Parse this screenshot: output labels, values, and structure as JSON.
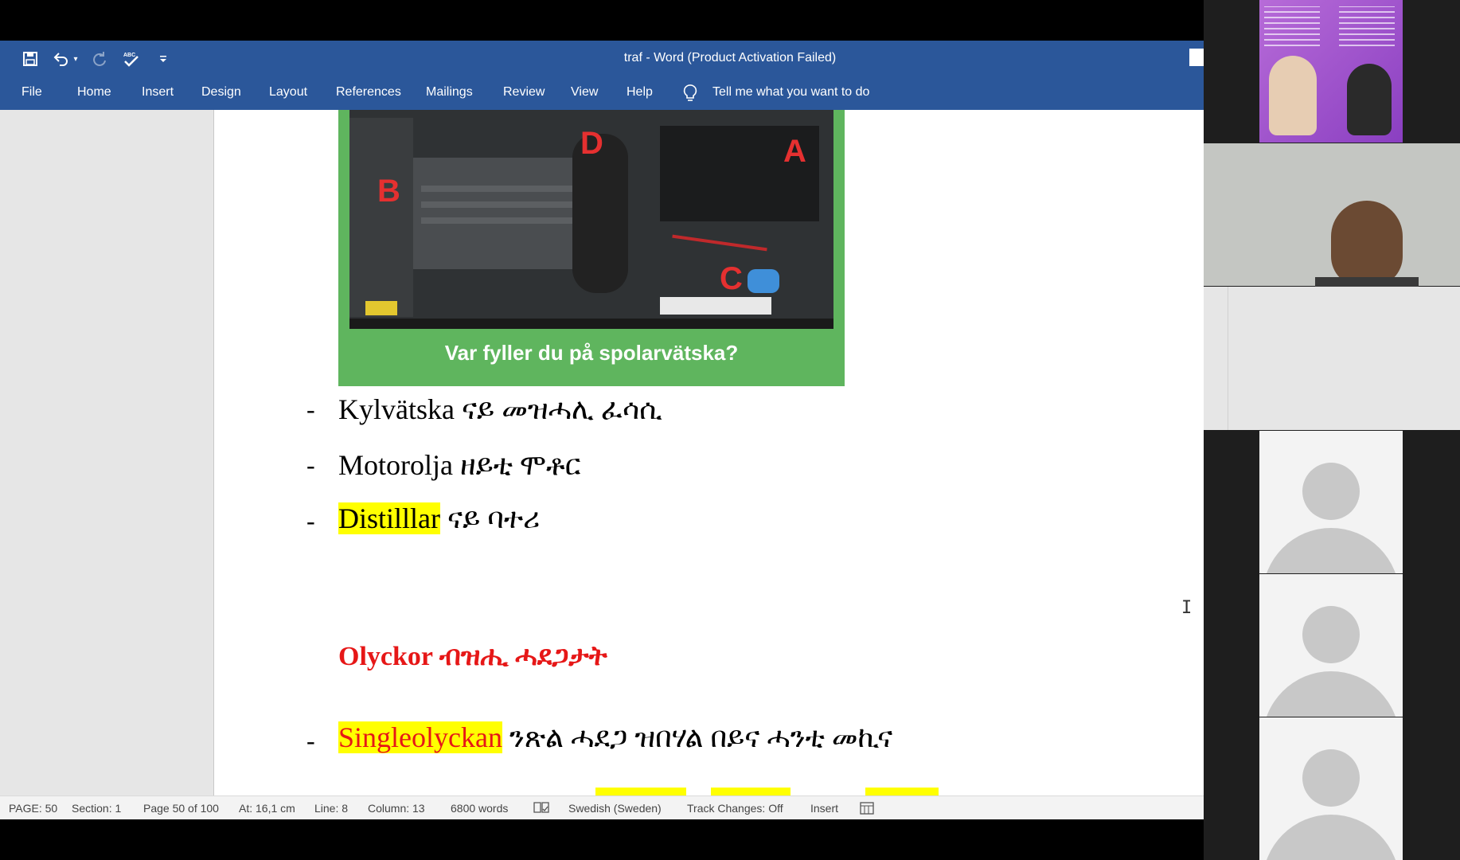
{
  "window": {
    "title": "traf  -  Word (Product Activation Failed)"
  },
  "quick_access": {
    "save_icon": "save-icon",
    "undo_icon": "undo-icon",
    "redo_icon": "redo-icon",
    "spelling_icon": "spelling-check-icon",
    "customize_icon": "customize-dropdown-icon"
  },
  "ribbon": {
    "tabs": [
      "File",
      "Home",
      "Insert",
      "Design",
      "Layout",
      "References",
      "Mailings",
      "Review",
      "View",
      "Help"
    ],
    "tell_me": "Tell me what you want to do"
  },
  "document": {
    "image_caption": "Var fyller du på spolarvätska?",
    "image_labels": [
      "D",
      "A",
      "B",
      "C"
    ],
    "lines": [
      {
        "dash": "-",
        "swedish": "Kylvätska",
        "tigrinya": " ናይ መዝሓሊ ፈሳሲ"
      },
      {
        "dash": "-",
        "swedish": "Motorolja",
        "tigrinya": " ዘይቲ ሞቶር"
      },
      {
        "dash": "-",
        "swedish": "Distilllar",
        "tigrinya": " ናይ ባተሪ"
      }
    ],
    "heading": {
      "swedish": "Olyckor",
      "tigrinya": " ብዝሒ ሓደጋታት"
    },
    "single": {
      "dash": "-",
      "swedish": "Singleolyckan",
      "tigrinya": " ንጽል ሓደጋ ዝበሃል በይና ሓንቲ መኪና"
    }
  },
  "status": {
    "page": "PAGE: 50",
    "section": "Section: 1",
    "page_of": "Page 50 of 100",
    "at": "At: 16,1 cm",
    "line": "Line: 8",
    "column": "Column: 13",
    "words": "6800 words",
    "language": "Swedish (Sweden)",
    "track_changes": "Track Changes: Off",
    "mode": "Insert"
  },
  "colors": {
    "ribbon": "#2b579a",
    "highlight": "#ffff00",
    "heading_red": "#e61717",
    "image_green": "#5fb55e"
  }
}
